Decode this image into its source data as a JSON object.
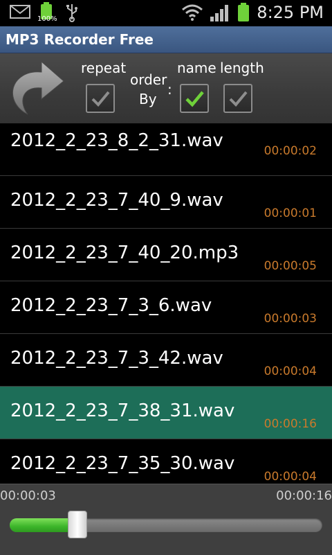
{
  "status_bar": {
    "time": "8:25 PM",
    "battery_percent": "100%",
    "icons": [
      "mail-icon",
      "battery-icon",
      "usb-icon",
      "wifi-icon",
      "signal-icon",
      "battery-full-icon"
    ]
  },
  "app": {
    "title": "MP3 Recorder Free"
  },
  "toolbar": {
    "back_icon": "back-arrow-icon",
    "repeat_label": "repeat",
    "order_label": "order",
    "by_label": "By",
    "colon": ":",
    "name_label": "name",
    "length_label": "length",
    "repeat_checked": false,
    "name_checked": true,
    "length_checked": false
  },
  "recordings": [
    {
      "name": "2012_2_23_8_2_31.wav",
      "duration": "00:00:02",
      "selected": false
    },
    {
      "name": "2012_2_23_7_40_9.wav",
      "duration": "00:00:01",
      "selected": false
    },
    {
      "name": "2012_2_23_7_40_20.mp3",
      "duration": "00:00:05",
      "selected": false
    },
    {
      "name": "2012_2_23_7_3_6.wav",
      "duration": "00:00:03",
      "selected": false
    },
    {
      "name": "2012_2_23_7_3_42.wav",
      "duration": "00:00:04",
      "selected": false
    },
    {
      "name": "2012_2_23_7_38_31.wav",
      "duration": "00:00:16",
      "selected": true
    },
    {
      "name": "2012_2_23_7_35_30.wav",
      "duration": "00:00:04",
      "selected": false
    }
  ],
  "player": {
    "current_time": "00:00:03",
    "total_time": "00:00:16",
    "progress_fraction": 0.19
  },
  "colors": {
    "title_bar": "#3f5f8c",
    "selected_row": "#1d6e58",
    "duration_text": "#c97a2c",
    "progress_fill": "#3cb52a",
    "check_green": "#6fd13a"
  }
}
